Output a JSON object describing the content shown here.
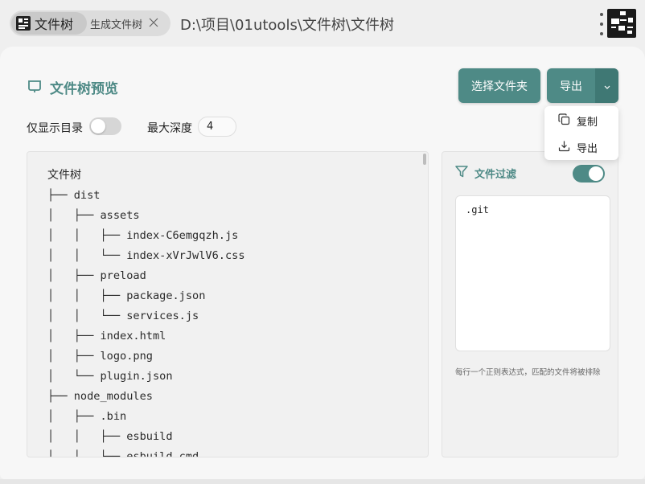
{
  "tabs": [
    {
      "label": "文件树"
    },
    {
      "label": "生成文件树"
    }
  ],
  "path": "D:\\项目\\01utools\\文件树\\文件树",
  "header": {
    "title": "文件树预览"
  },
  "buttons": {
    "select_folder": "选择文件夹",
    "export": "导出"
  },
  "options": {
    "dirs_only_label": "仅显示目录",
    "dirs_only": false,
    "max_depth_label": "最大深度",
    "max_depth": "4"
  },
  "tree": {
    "lines": [
      "文件树",
      "├── dist",
      "│   ├── assets",
      "│   │   ├── index-C6emgqzh.js",
      "│   │   └── index-xVrJwlV6.css",
      "│   ├── preload",
      "│   │   ├── package.json",
      "│   │   └── services.js",
      "│   ├── index.html",
      "│   ├── logo.png",
      "│   └── plugin.json",
      "├── node_modules",
      "│   ├── .bin",
      "│   │   ├── esbuild",
      "│   │   └── esbuild.cmd"
    ]
  },
  "filter": {
    "title": "文件过滤",
    "enabled": true,
    "value": ".git",
    "hint": "每行一个正则表达式，匹配的文件将被排除"
  },
  "dropdown": {
    "items": [
      {
        "label": "复制",
        "icon": "copy-icon"
      },
      {
        "label": "导出",
        "icon": "download-icon"
      }
    ]
  },
  "colors": {
    "accent": "#4e8a86",
    "accent_dark": "#3f7874"
  }
}
